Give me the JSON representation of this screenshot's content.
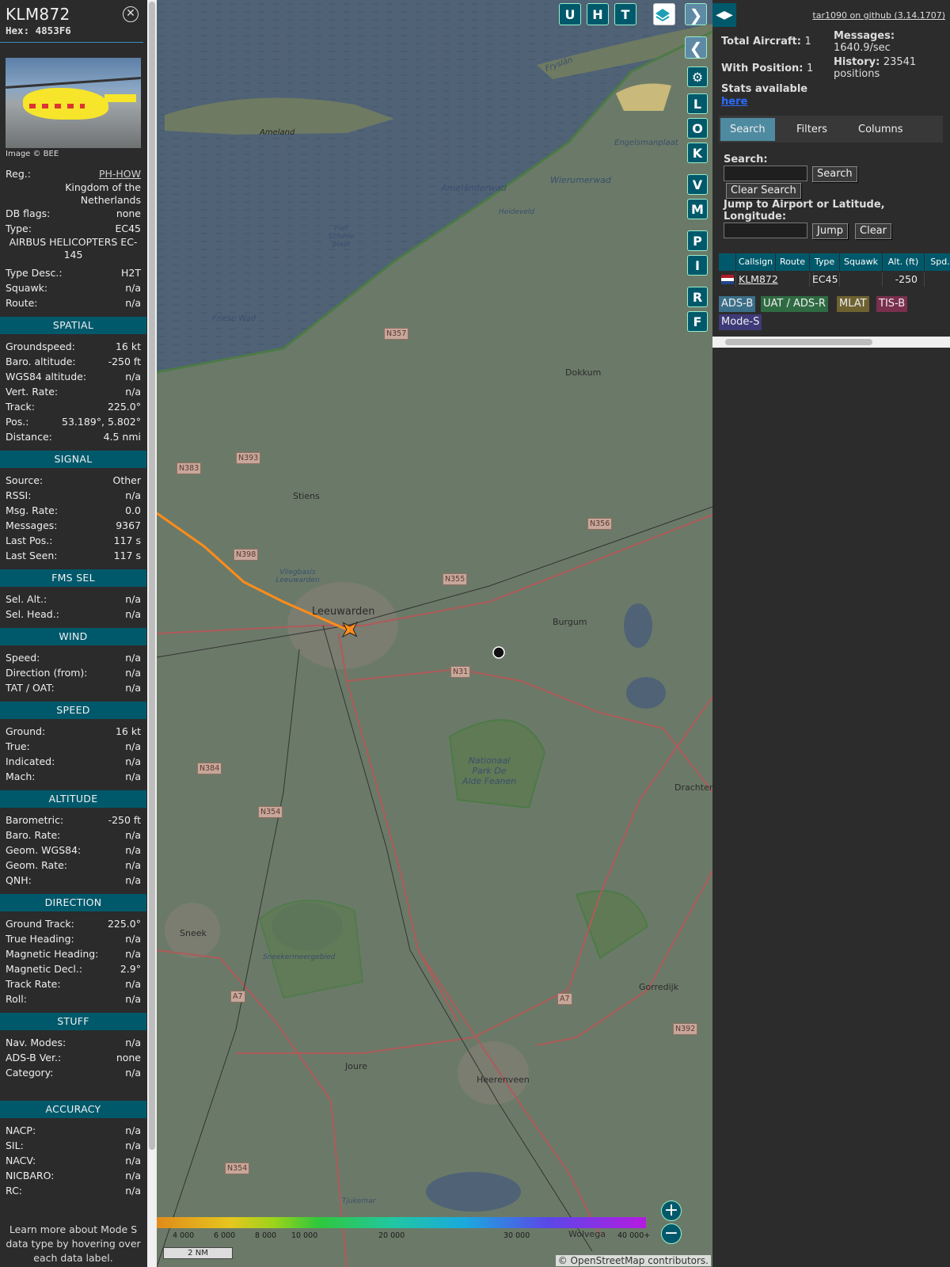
{
  "info": {
    "callsign": "KLM872",
    "hex": "Hex: 4853F6",
    "image_credit": "Image © BEE",
    "reg_label": "Reg.:",
    "reg_value": "PH-HOW",
    "country": "Kingdom of the Netherlands",
    "dbflags_label": "DB flags:",
    "dbflags_value": "none",
    "type_label": "Type:",
    "type_value": "EC45",
    "type_full": "AIRBUS HELICOPTERS EC-145",
    "typedesc_label": "Type Desc.:",
    "typedesc_value": "H2T",
    "squawk_label": "Squawk:",
    "squawk_value": "n/a",
    "route_label": "Route:",
    "route_value": "n/a",
    "sections": {
      "spatial": "SPATIAL",
      "signal": "SIGNAL",
      "fms": "FMS SEL",
      "wind": "WIND",
      "speed": "SPEED",
      "altitude": "ALTITUDE",
      "direction": "DIRECTION",
      "stuff": "STUFF",
      "accuracy": "ACCURACY"
    },
    "spatial": [
      [
        "Groundspeed:",
        "16 kt"
      ],
      [
        "Baro. altitude:",
        "-250 ft"
      ],
      [
        "WGS84 altitude:",
        "n/a"
      ],
      [
        "Vert. Rate:",
        "n/a"
      ],
      [
        "Track:",
        "225.0°"
      ],
      [
        "Pos.:",
        "53.189°, 5.802°"
      ],
      [
        "Distance:",
        "4.5 nmi"
      ]
    ],
    "signal": [
      [
        "Source:",
        "Other"
      ],
      [
        "RSSI:",
        "n/a"
      ],
      [
        "Msg. Rate:",
        "0.0"
      ],
      [
        "Messages:",
        "9367"
      ],
      [
        "Last Pos.:",
        "117 s"
      ],
      [
        "Last Seen:",
        "117 s"
      ]
    ],
    "fms": [
      [
        "Sel. Alt.:",
        "n/a"
      ],
      [
        "Sel. Head.:",
        "n/a"
      ]
    ],
    "wind": [
      [
        "Speed:",
        "n/a"
      ],
      [
        "Direction (from):",
        "n/a"
      ],
      [
        "TAT / OAT:",
        "n/a"
      ]
    ],
    "speed": [
      [
        "Ground:",
        "16 kt"
      ],
      [
        "True:",
        "n/a"
      ],
      [
        "Indicated:",
        "n/a"
      ],
      [
        "Mach:",
        "n/a"
      ]
    ],
    "altitude": [
      [
        "Barometric:",
        "-250 ft"
      ],
      [
        "Baro. Rate:",
        "n/a"
      ],
      [
        "Geom. WGS84:",
        "n/a"
      ],
      [
        "Geom. Rate:",
        "n/a"
      ],
      [
        "QNH:",
        "n/a"
      ]
    ],
    "direction": [
      [
        "Ground Track:",
        "225.0°"
      ],
      [
        "True Heading:",
        "n/a"
      ],
      [
        "Magnetic Heading:",
        "n/a"
      ],
      [
        "Magnetic Decl.:",
        "2.9°"
      ],
      [
        "Track Rate:",
        "n/a"
      ],
      [
        "Roll:",
        "n/a"
      ]
    ],
    "stuff": [
      [
        "Nav. Modes:",
        "n/a"
      ],
      [
        "ADS-B Ver.:",
        "none"
      ],
      [
        "Category:",
        "n/a"
      ]
    ],
    "accuracy": [
      [
        "NACP:",
        "n/a"
      ],
      [
        "SIL:",
        "n/a"
      ],
      [
        "NACV:",
        "n/a"
      ],
      [
        "NICBARO:",
        "n/a"
      ],
      [
        "RC:",
        "n/a"
      ]
    ],
    "footer": "Learn more about Mode S data type by hovering over each data label."
  },
  "map": {
    "buttons": [
      "U",
      "H",
      "T"
    ],
    "side_buttons": [
      "L",
      "O",
      "K",
      "V",
      "M",
      "P",
      "I",
      "R",
      "F"
    ],
    "places": {
      "ameland": "Ameland",
      "friesland": "Fryslân",
      "engelsmanplaat": "Engelsmanplaat",
      "amelanderwad": "Amelânderwad",
      "wierumerwad": "Wierumerwad",
      "heideveld": "Heideveld",
      "pietscheve": "Piet Scheve plaat",
      "friesewad": "Friese Wad",
      "dokkum": "Dokkum",
      "stiens": "Stiens",
      "vliegbasis": "Vliegbasis Leeuwarden",
      "leeuwarden": "Leeuwarden",
      "burgum": "Burgum",
      "nationaal": "Nationaal Park De Alde Feanen",
      "drachten": "Drachten",
      "sneek": "Sneek",
      "sneekermeer": "Sneekermeergebied",
      "gorredijk": "Gorredijk",
      "joure": "Joure",
      "heerenveen": "Heerenveen",
      "tjukemar": "Tjukemar",
      "wolvega": "Wolvega"
    },
    "roads": {
      "n357": "N357",
      "n383": "N383",
      "n393": "N393",
      "n398": "N398",
      "n355": "N355",
      "n356": "N356",
      "n31": "N31",
      "n384": "N384",
      "n354a": "N354",
      "a7a": "A7",
      "a7b": "A7",
      "n392": "N392",
      "n354b": "N354"
    },
    "alt_labels": [
      "4 000",
      "6 000",
      "8 000",
      "10 000",
      "20 000",
      "30 000",
      "40 000+"
    ],
    "scale": "2 NM",
    "attribution": "© OpenStreetMap contributors."
  },
  "right": {
    "github": "tar1090 on github (3.14.1707)",
    "total_label": "Total Aircraft:",
    "total_value": "1",
    "withpos_label": "With Position:",
    "withpos_value": "1",
    "stats_label": "Stats available",
    "stats_link": "here",
    "messages_label": "Messages:",
    "messages_value": "1640.9/sec",
    "history_label": "History:",
    "history_value": "23541 positions",
    "tabs": [
      "Search",
      "Filters",
      "Columns"
    ],
    "search_label": "Search:",
    "search_btn": "Search",
    "clear_search_btn": "Clear Search",
    "jump_label": "Jump to Airport or Latitude, Longitude:",
    "jump_btn": "Jump",
    "clear_btn": "Clear",
    "columns": [
      "Callsign",
      "Route",
      "Type",
      "Squawk",
      "Alt. (ft)",
      "Spd."
    ],
    "row": {
      "callsign": "KLM872",
      "route": "",
      "type": "EC45",
      "squawk": "",
      "alt": "-250"
    },
    "legend": [
      "ADS-B",
      "UAT / ADS-R",
      "MLAT",
      "TIS-B",
      "Mode-S"
    ]
  },
  "colors": {
    "panel_bg": "#2b2b2b",
    "section_bg": "#00596b",
    "track": "#ff8c1a",
    "adsb": "#3b6f89",
    "uat": "#2f6b42",
    "mlat": "#6f6231",
    "tisb": "#7a2f4d",
    "modes": "#3e3a78"
  }
}
